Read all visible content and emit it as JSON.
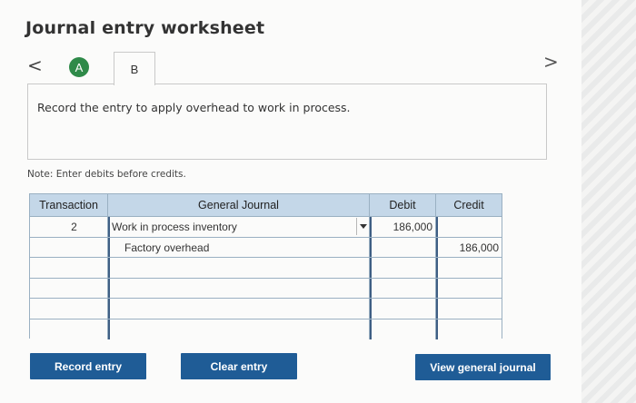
{
  "title": "Journal entry worksheet",
  "nav": {
    "prev_glyph": "<",
    "next_glyph": ">",
    "tabs": [
      {
        "label": "A",
        "state": "completed",
        "color": "#2f8a49"
      },
      {
        "label": "B",
        "state": "active"
      }
    ]
  },
  "instruction": "Record the entry to apply overhead to work in process.",
  "note": "Note: Enter debits before credits.",
  "journal": {
    "headers": {
      "transaction": "Transaction",
      "general_journal": "General Journal",
      "debit": "Debit",
      "credit": "Credit"
    },
    "rows": [
      {
        "transaction": "2",
        "account": "Work in process inventory",
        "debit": "186,000",
        "credit": "",
        "indent": false
      },
      {
        "transaction": "",
        "account": "Factory overhead",
        "debit": "",
        "credit": "186,000",
        "indent": true
      },
      {
        "transaction": "",
        "account": "",
        "debit": "",
        "credit": "",
        "indent": false
      },
      {
        "transaction": "",
        "account": "",
        "debit": "",
        "credit": "",
        "indent": false
      },
      {
        "transaction": "",
        "account": "",
        "debit": "",
        "credit": "",
        "indent": false
      },
      {
        "transaction": "",
        "account": "",
        "debit": "",
        "credit": "",
        "indent": false
      }
    ],
    "header_color": "#c4d7e8"
  },
  "buttons": {
    "record": "Record entry",
    "clear": "Clear entry",
    "view": "View general journal",
    "color": "#1f5c96"
  },
  "icons": {
    "dropdown": "chevron-down-icon"
  }
}
